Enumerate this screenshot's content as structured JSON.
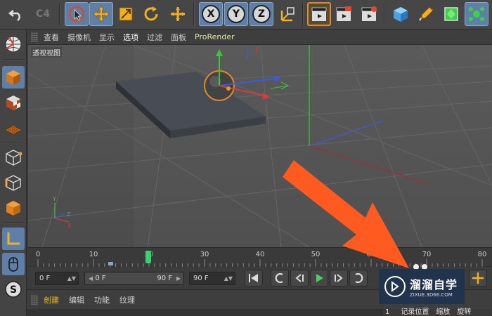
{
  "viewport_menu": {
    "items": [
      {
        "label": "查看"
      },
      {
        "label": "摄像机"
      },
      {
        "label": "显示"
      },
      {
        "label": "选项"
      },
      {
        "label": "过滤"
      },
      {
        "label": "面板"
      },
      {
        "label": "ProRender"
      }
    ]
  },
  "viewport": {
    "label": "透视视图"
  },
  "toolbar": {
    "axis_x": "X",
    "axis_y": "Y",
    "axis_z": "Z",
    "redo_label": "C4"
  },
  "timeline": {
    "ticks": [
      "0",
      "10",
      "20",
      "30",
      "40",
      "50",
      "60",
      "70",
      "80"
    ],
    "current_frame": 20
  },
  "transport": {
    "start_frame": "0 F",
    "range_start": "0 F",
    "range_end": "90 F",
    "end_frame": "90 F"
  },
  "material_menu": {
    "items": [
      {
        "label": "创建"
      },
      {
        "label": "编辑"
      },
      {
        "label": "功能"
      },
      {
        "label": "纹理"
      }
    ]
  },
  "coordinates": {
    "tabs": [
      "记录位置",
      "缩放",
      "旋转"
    ],
    "partial_value": "1"
  },
  "watermark": {
    "title": "溜溜自学",
    "subtitle": "ZIXUE.3D66.COM"
  },
  "colors": {
    "accent_blue": "#5e7fa8",
    "accent_orange": "#e38a2c",
    "annotation_arrow": "#ff5a1f",
    "axis_x": "#d23c3c",
    "axis_y": "#3cc43c",
    "axis_z": "#3c5adc"
  }
}
